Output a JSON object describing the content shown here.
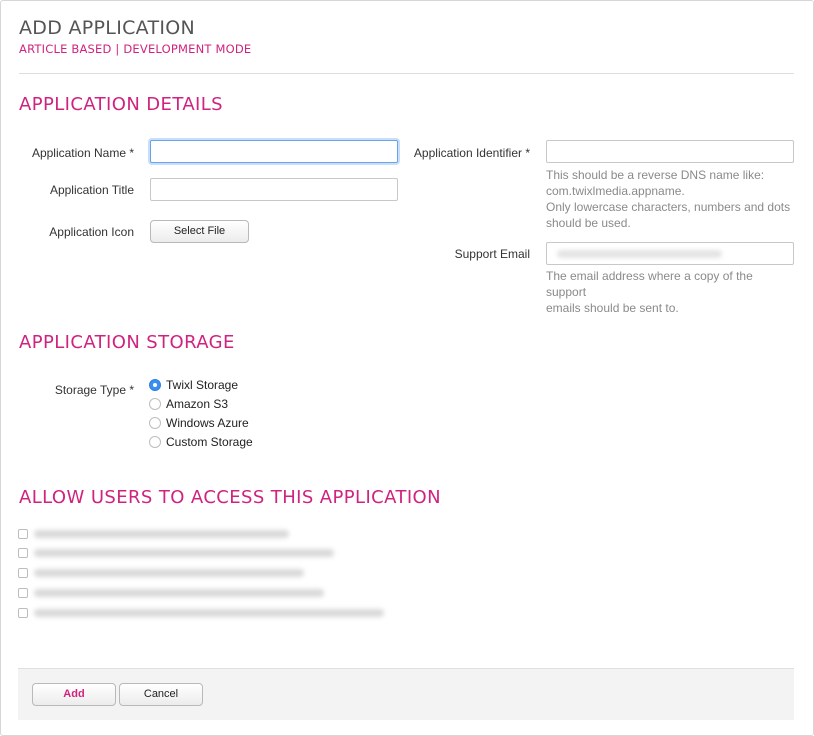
{
  "header": {
    "title": "ADD APPLICATION",
    "subtitle": "ARTICLE BASED | DEVELOPMENT MODE"
  },
  "details": {
    "section_title": "APPLICATION DETAILS",
    "app_name_label": "Application Name *",
    "app_name_value": "",
    "app_title_label": "Application Title",
    "app_title_value": "",
    "app_icon_label": "Application Icon",
    "select_file_label": "Select File",
    "app_identifier_label": "Application Identifier *",
    "app_identifier_value": "",
    "app_identifier_help": [
      "This should be a reverse DNS name like:",
      "com.twixlmedia.appname.",
      "Only lowercase characters, numbers and dots",
      "should be used."
    ],
    "support_email_label": "Support Email",
    "support_email_help": [
      "The email address where a copy of the support",
      "emails should be sent to."
    ]
  },
  "storage": {
    "section_title": "APPLICATION STORAGE",
    "type_label": "Storage Type *",
    "options": [
      {
        "label": "Twixl Storage",
        "checked": true
      },
      {
        "label": "Amazon S3",
        "checked": false
      },
      {
        "label": "Windows Azure",
        "checked": false
      },
      {
        "label": "Custom Storage",
        "checked": false
      }
    ]
  },
  "users": {
    "section_title": "ALLOW USERS TO ACCESS THIS APPLICATION",
    "count_rows": 5
  },
  "footer": {
    "add_label": "Add",
    "cancel_label": "Cancel"
  },
  "colors": {
    "accent": "#d0237f",
    "radio_selected": "#3b8ff0"
  }
}
